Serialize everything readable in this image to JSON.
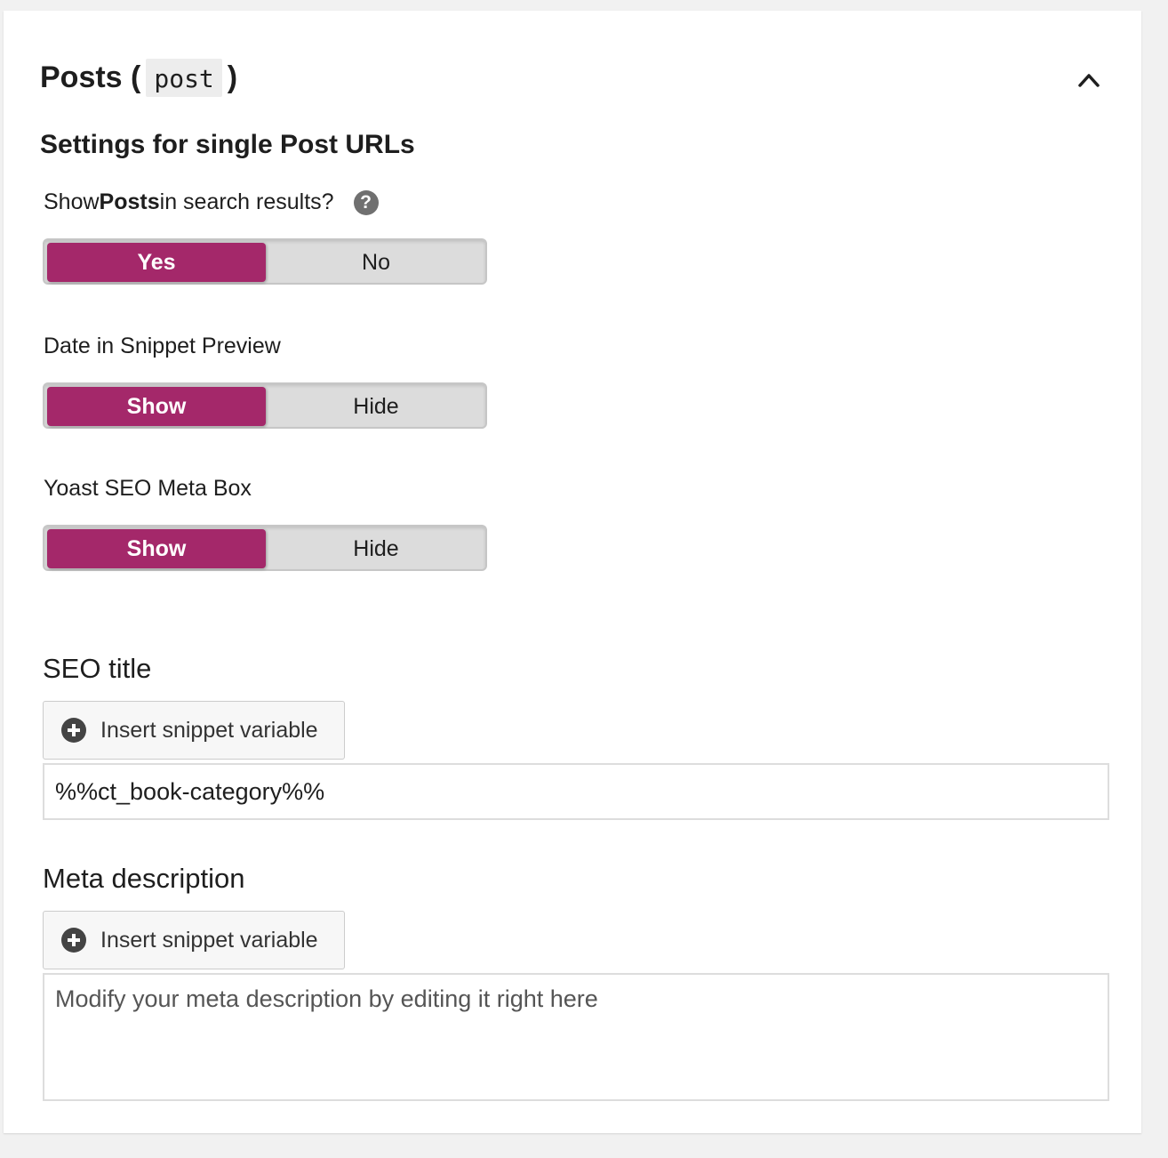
{
  "panel": {
    "title_prefix": "Posts (",
    "title_code": "post",
    "title_suffix": ")",
    "collapse_icon": "chevron-up-icon"
  },
  "settings": {
    "heading": "Settings for single Post URLs",
    "search_results": {
      "label_before": "Show ",
      "label_bold": "Posts",
      "label_after": " in search results?",
      "help_icon": "question-circle-icon",
      "help_glyph": "?",
      "options": [
        "Yes",
        "No"
      ],
      "selected": "Yes"
    },
    "date_snippet": {
      "label": "Date in Snippet Preview",
      "options": [
        "Show",
        "Hide"
      ],
      "selected": "Show"
    },
    "meta_box": {
      "label": "Yoast SEO Meta Box",
      "options": [
        "Show",
        "Hide"
      ],
      "selected": "Show"
    }
  },
  "seo_title": {
    "label": "SEO title",
    "insert_button": "Insert snippet variable",
    "value": "%%ct_book-category%%"
  },
  "meta_description": {
    "label": "Meta description",
    "insert_button": "Insert snippet variable",
    "placeholder": "Modify your meta description by editing it right here"
  },
  "colors": {
    "accent": "#a4286a",
    "toggle_bg": "#dcdcdc",
    "panel_bg": "#ffffff",
    "page_bg": "#f1f1f1"
  }
}
